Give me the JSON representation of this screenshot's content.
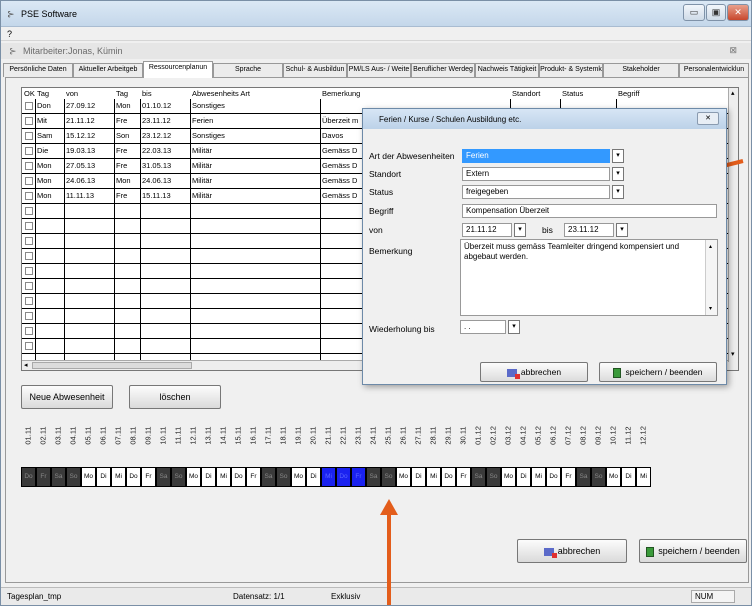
{
  "app": {
    "title": "PSE Software",
    "menu": "?"
  },
  "subwindow": {
    "title": "Mitarbeiter:Jonas, Kümin"
  },
  "tabs": [
    "Persönliche Daten",
    "Aktueller Arbeitgeb",
    "Ressourcenplanun",
    "Sprache",
    "Schul- & Ausbildun",
    "PM/LS Aus- / Weite",
    "Beruflicher Werdeg",
    "Nachweis Tätigkeit",
    "Produkt- & Systemk",
    "Stakeholder",
    "Personalentwicklun"
  ],
  "grid": {
    "headers": {
      "ok": "OK",
      "tag": "Tag",
      "von": "von",
      "tag2": "Tag",
      "bis": "bis",
      "art": "Abwesenheits Art",
      "bemerkung": "Bemerkung",
      "standort": "Standort",
      "status": "Status",
      "begriff": "Begriff"
    },
    "rows": [
      {
        "tag": "Don",
        "von": "27.09.12",
        "tag2": "Mon",
        "bis": "01.10.12",
        "art": "Sonstiges",
        "bem": ""
      },
      {
        "tag": "Mit",
        "von": "21.11.12",
        "tag2": "Fre",
        "bis": "23.11.12",
        "art": "Ferien",
        "bem": "Überzeit m"
      },
      {
        "tag": "Sam",
        "von": "15.12.12",
        "tag2": "Son",
        "bis": "23.12.12",
        "art": "Sonstiges",
        "bem": "Davos"
      },
      {
        "tag": "Die",
        "von": "19.03.13",
        "tag2": "Fre",
        "bis": "22.03.13",
        "art": "Militär",
        "bem": "Gemäss D"
      },
      {
        "tag": "Mon",
        "von": "27.05.13",
        "tag2": "Fre",
        "bis": "31.05.13",
        "art": "Militär",
        "bem": "Gemäss D"
      },
      {
        "tag": "Mon",
        "von": "24.06.13",
        "tag2": "Mon",
        "bis": "24.06.13",
        "art": "Militär",
        "bem": "Gemäss D"
      },
      {
        "tag": "Mon",
        "von": "11.11.13",
        "tag2": "Fre",
        "bis": "15.11.13",
        "art": "Militär",
        "bem": "Gemäss D"
      }
    ]
  },
  "buttons": {
    "neue": "Neue Abwesenheit",
    "loeschen": "löschen",
    "abbrechen": "abbrechen",
    "speichern": "speichern / beenden"
  },
  "calendar": {
    "dates": [
      "01.11",
      "02.11",
      "03.11",
      "04.11",
      "05.11",
      "06.11",
      "07.11",
      "08.11",
      "09.11",
      "10.11",
      "11.11",
      "12.11",
      "13.11",
      "14.11",
      "15.11",
      "16.11",
      "17.11",
      "18.11",
      "19.11",
      "20.11",
      "21.11",
      "22.11",
      "23.11",
      "24.11",
      "25.11",
      "26.11",
      "27.11",
      "28.11",
      "29.11",
      "30.11",
      "01.12",
      "02.12",
      "03.12",
      "04.12",
      "05.12",
      "06.12",
      "07.12",
      "08.12",
      "09.12",
      "10.12",
      "11.12",
      "12.12"
    ],
    "days": [
      {
        "l": "Do",
        "s": "dk"
      },
      {
        "l": "Fr",
        "s": "dk"
      },
      {
        "l": "Sa",
        "s": "dk"
      },
      {
        "l": "So",
        "s": "dk"
      },
      {
        "l": "Mo",
        "s": ""
      },
      {
        "l": "Di",
        "s": ""
      },
      {
        "l": "Mi",
        "s": ""
      },
      {
        "l": "Do",
        "s": ""
      },
      {
        "l": "Fr",
        "s": ""
      },
      {
        "l": "Sa",
        "s": "dk"
      },
      {
        "l": "So",
        "s": "dk"
      },
      {
        "l": "Mo",
        "s": ""
      },
      {
        "l": "Di",
        "s": ""
      },
      {
        "l": "Mi",
        "s": ""
      },
      {
        "l": "Do",
        "s": ""
      },
      {
        "l": "Fr",
        "s": ""
      },
      {
        "l": "Sa",
        "s": "dk"
      },
      {
        "l": "So",
        "s": "dk"
      },
      {
        "l": "Mo",
        "s": ""
      },
      {
        "l": "Di",
        "s": ""
      },
      {
        "l": "Mi",
        "s": "bl"
      },
      {
        "l": "Do",
        "s": "bl"
      },
      {
        "l": "Fr",
        "s": "bl"
      },
      {
        "l": "Sa",
        "s": "dk"
      },
      {
        "l": "So",
        "s": "dk"
      },
      {
        "l": "Mo",
        "s": ""
      },
      {
        "l": "Di",
        "s": ""
      },
      {
        "l": "Mi",
        "s": ""
      },
      {
        "l": "Do",
        "s": ""
      },
      {
        "l": "Fr",
        "s": ""
      },
      {
        "l": "Sa",
        "s": "dk"
      },
      {
        "l": "So",
        "s": "dk"
      },
      {
        "l": "Mo",
        "s": ""
      },
      {
        "l": "Di",
        "s": ""
      },
      {
        "l": "Mi",
        "s": ""
      },
      {
        "l": "Do",
        "s": ""
      },
      {
        "l": "Fr",
        "s": ""
      },
      {
        "l": "Sa",
        "s": "dk"
      },
      {
        "l": "So",
        "s": "dk"
      },
      {
        "l": "Mo",
        "s": ""
      },
      {
        "l": "Di",
        "s": ""
      },
      {
        "l": "Mi",
        "s": ""
      }
    ]
  },
  "dialog": {
    "title": "Ferien / Kurse / Schulen Ausbildung etc.",
    "labels": {
      "art": "Art der Abwesenheiten",
      "standort": "Standort",
      "status": "Status",
      "begriff": "Begriff",
      "von": "von",
      "bis": "bis",
      "bemerkung": "Bemerkung",
      "wiederholung": "Wiederholung bis"
    },
    "values": {
      "art": "Ferien",
      "standort": "Extern",
      "status": "freigegeben",
      "begriff": "Kompensation Überzeit",
      "von": "21.11.12",
      "bis": "23.11.12",
      "bemerkung": "Überzeit muss gemäss Teamleiter dringend kompensiert und abgebaut werden.",
      "wiederholung": ". ."
    },
    "buttons": {
      "abbrechen": "abbrechen",
      "speichern": "speichern / beenden"
    }
  },
  "status": {
    "left": "Tagesplan_tmp",
    "record": "Datensatz: 1/1",
    "mode": "Exklusiv",
    "num": "NUM"
  },
  "colors": {
    "accent_arrow": "#e35d1b",
    "selected_day": "#1a22f0",
    "weekend": "#3a3a3a",
    "selection": "#3399ff"
  }
}
